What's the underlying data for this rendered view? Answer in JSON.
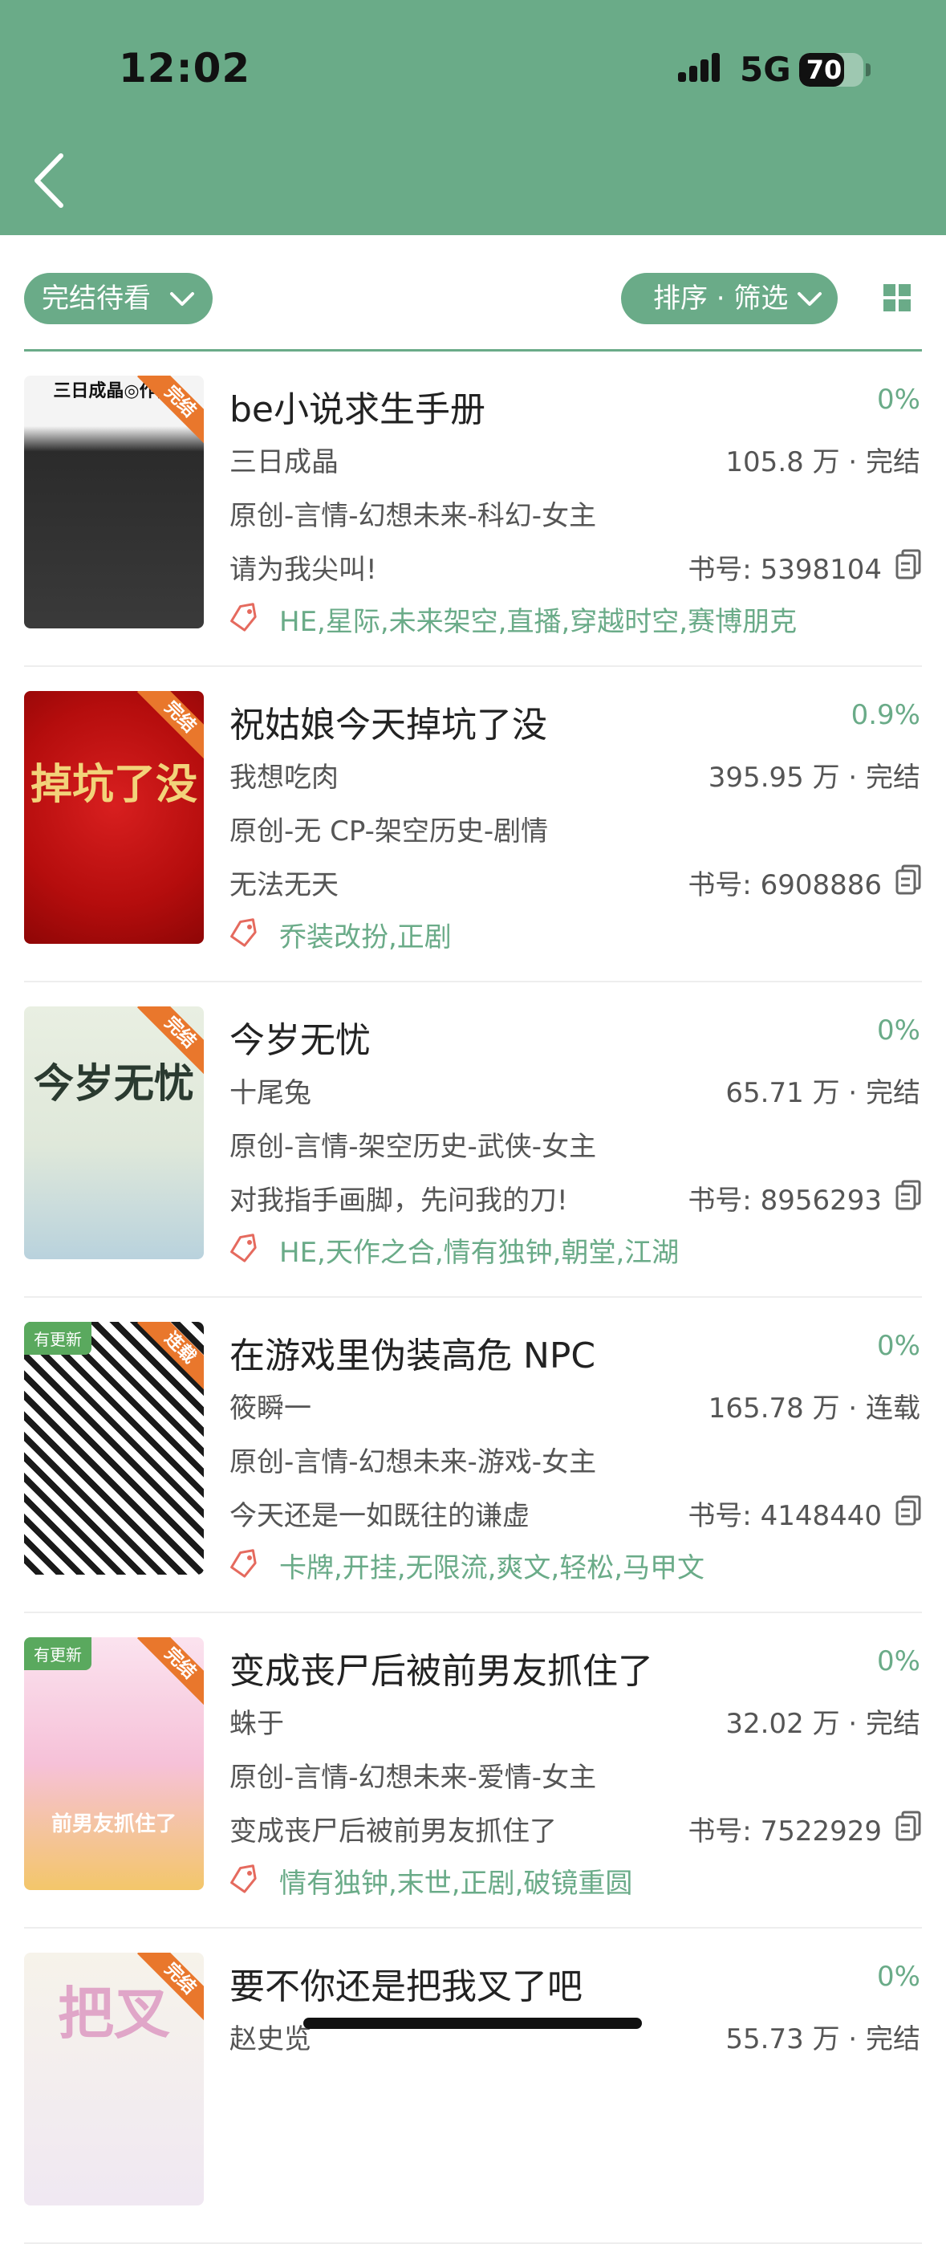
{
  "status_bar": {
    "time": "12:02",
    "network": "5G",
    "battery": "70",
    "battery_level": 0.7
  },
  "nav": {
    "back_icon": "chevron-left-icon"
  },
  "filters": {
    "shelf_label": "完结待看",
    "sort_label": "排序 · 筛选",
    "layout_icon": "grid-view-icon"
  },
  "colors": {
    "accent": "#6aab88",
    "ribbon": "#e9772c",
    "update_badge": "#5aa95e"
  },
  "books": [
    {
      "title": "be小说求生手册",
      "progress": "0%",
      "author": "三日成晶",
      "stats": "105.8 万 · 完结",
      "category": "原创-言情-幻想未来-科幻-女主",
      "intro": "请为我尖叫!",
      "book_no": "书号: 5398104",
      "tags": "HE,星际,未来架空,直播,穿越时空,赛博朋克",
      "ribbon": "完结",
      "badge": "",
      "cover_text": "三日成晶◎作品"
    },
    {
      "title": "祝姑娘今天掉坑了没",
      "progress": "0.9%",
      "author": "我想吃肉",
      "stats": "395.95 万 · 完结",
      "category": "原创-无 CP-架空历史-剧情",
      "intro": "无法无天",
      "book_no": "书号: 6908886",
      "tags": "乔装改扮,正剧",
      "ribbon": "完结",
      "badge": "",
      "cover_text": "掉坑了没"
    },
    {
      "title": "今岁无忧",
      "progress": "0%",
      "author": "十尾兔",
      "stats": "65.71 万 · 完结",
      "category": "原创-言情-架空历史-武侠-女主",
      "intro": "对我指手画脚，先问我的刀!",
      "book_no": "书号: 8956293",
      "tags": "HE,天作之合,情有独钟,朝堂,江湖",
      "ribbon": "完结",
      "badge": "",
      "cover_text": "今岁无忧"
    },
    {
      "title": "在游戏里伪装高危 NPC",
      "progress": "0%",
      "author": "筱瞬一",
      "stats": "165.78 万 · 连载",
      "category": "原创-言情-幻想未来-游戏-女主",
      "intro": "今天还是一如既往的谦虚",
      "book_no": "书号: 4148440",
      "tags": "卡牌,开挂,无限流,爽文,轻松,马甲文",
      "ribbon": "连载",
      "badge": "有更新",
      "cover_text": ""
    },
    {
      "title": "变成丧尸后被前男友抓住了",
      "progress": "0%",
      "author": "蛛于",
      "stats": "32.02 万 · 完结",
      "category": "原创-言情-幻想未来-爱情-女主",
      "intro": "变成丧尸后被前男友抓住了",
      "book_no": "书号: 7522929",
      "tags": "情有独钟,末世,正剧,破镜重圆",
      "ribbon": "完结",
      "badge": "有更新",
      "cover_text": "前男友抓住了"
    },
    {
      "title": "要不你还是把我叉了吧",
      "progress": "0%",
      "author": "赵史览",
      "stats": "55.73 万 · 完结",
      "category": "",
      "intro": "",
      "book_no": "",
      "tags": "",
      "ribbon": "完结",
      "badge": "",
      "cover_text": "把叉"
    }
  ]
}
